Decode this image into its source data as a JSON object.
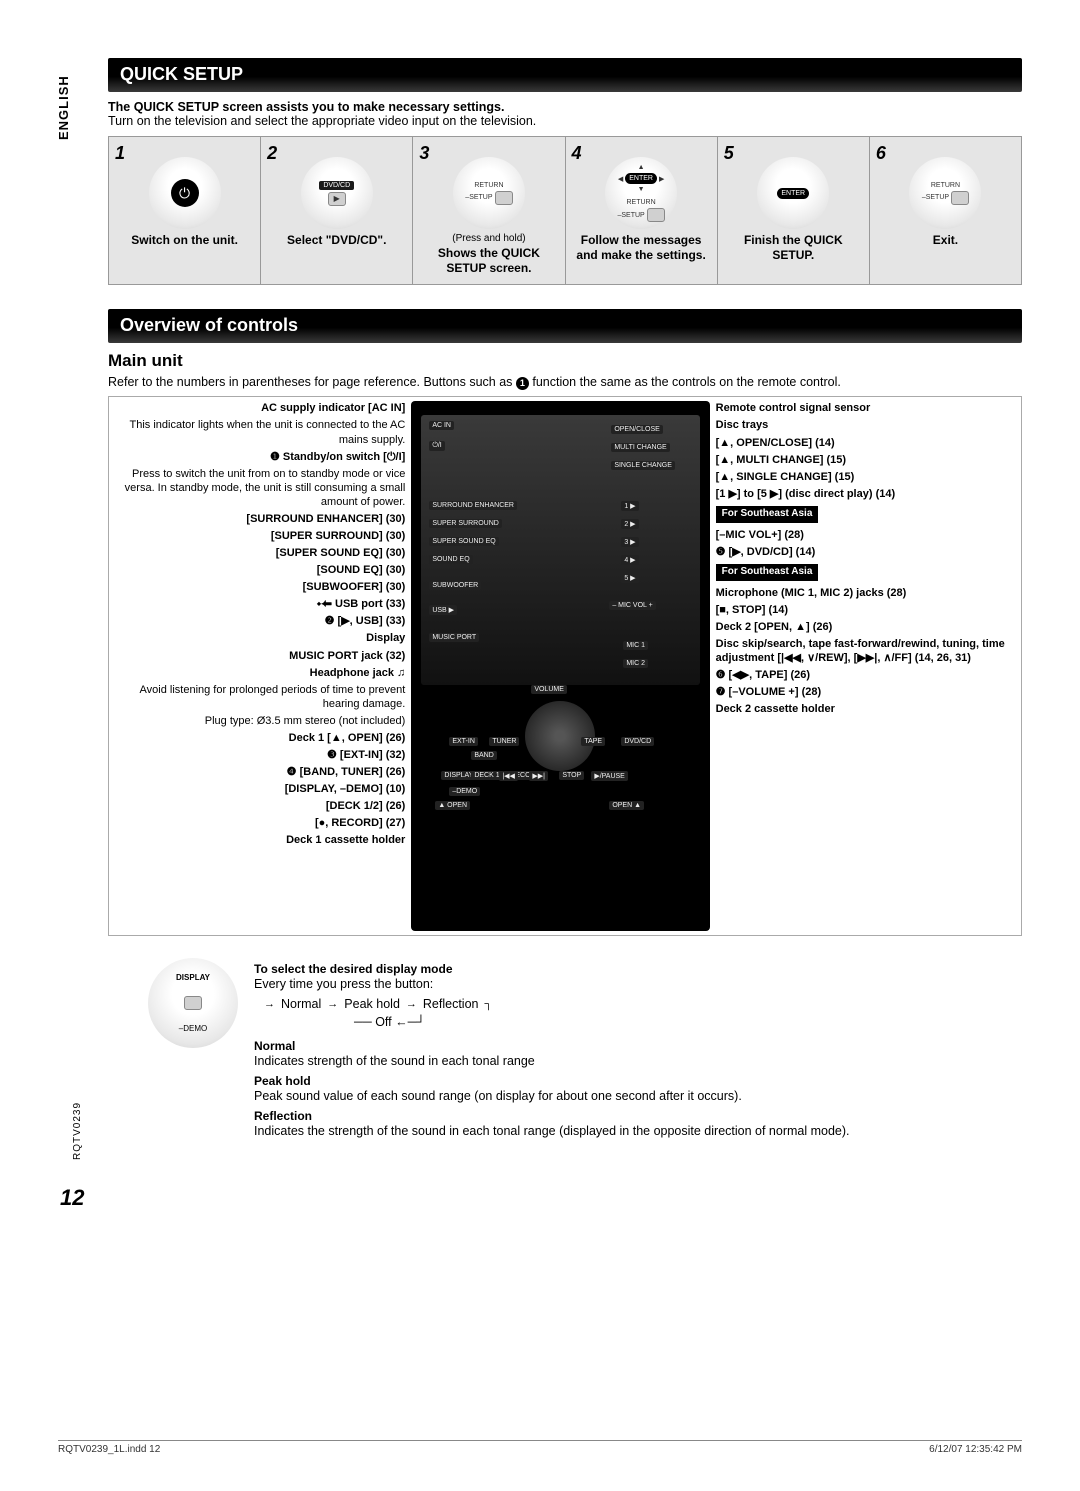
{
  "lang_tab": "ENGLISH",
  "page_number": "12",
  "doc_code": "RQTV0239",
  "section1": {
    "title": "QUICK SETUP",
    "lead_bold": "The QUICK SETUP screen assists you to make necessary settings.",
    "lead": "Turn on the television and select the appropriate video input on the television."
  },
  "steps": [
    {
      "n": "1",
      "label": "Switch on the unit.",
      "btn": {
        "type": "power"
      }
    },
    {
      "n": "2",
      "label": "Select \"DVD/CD\".",
      "btn": {
        "type": "dvdcd",
        "top": "DVD/CD"
      }
    },
    {
      "n": "3",
      "label": "Shows the QUICK SETUP screen.",
      "btn": {
        "type": "setup",
        "top": "RETURN",
        "left": "–SETUP"
      },
      "sub": "(Press and hold)"
    },
    {
      "n": "4",
      "label": "Follow the messages and make the settings.",
      "btn": {
        "type": "nav",
        "enter": "ENTER",
        "ret": "RETURN",
        "setup": "–SETUP"
      }
    },
    {
      "n": "5",
      "label": "Finish the QUICK SETUP.",
      "btn": {
        "type": "enter",
        "enter": "ENTER"
      }
    },
    {
      "n": "6",
      "label": "Exit.",
      "btn": {
        "type": "setup",
        "top": "RETURN",
        "left": "–SETUP"
      }
    }
  ],
  "section2": {
    "title": "Overview of controls",
    "sub": "Main unit",
    "desc_a": "Refer to the numbers in parentheses for page reference. Buttons such as ",
    "desc_b": " function the same as the controls on the remote control.",
    "circledRef": "1"
  },
  "left_callouts": [
    "AC supply indicator [AC IN]",
    "This indicator lights when the unit is connected to the AC mains supply.",
    "❶ Standby/on switch [⏻/I]",
    "Press to switch the unit from on to standby mode or vice versa. In standby mode, the unit is still consuming a small amount of power.",
    "[SURROUND ENHANCER] (30)",
    "[SUPER SURROUND] (30)",
    "[SUPER SOUND EQ] (30)",
    "[SOUND EQ] (30)",
    "[SUBWOOFER] (30)",
    "⬩⬅ USB port (33)",
    "❷ [▶, USB] (33)",
    "Display",
    "MUSIC PORT jack (32)",
    "Headphone jack ♫",
    "Avoid listening for prolonged periods of time to prevent hearing damage.",
    "Plug type: Ø3.5 mm stereo (not included)",
    "Deck 1 [▲, OPEN] (26)",
    "❸ [EXT-IN] (32)",
    "❹ [BAND, TUNER] (26)",
    "[DISPLAY, –DEMO] (10)",
    "[DECK 1/2] (26)",
    "[●, RECORD] (27)",
    "Deck 1 cassette holder"
  ],
  "right_callouts": [
    {
      "text": "Remote control signal sensor"
    },
    {
      "text": "Disc trays"
    },
    {
      "text": "[▲, OPEN/CLOSE] (14)"
    },
    {
      "text": "[▲, MULTI CHANGE] (15)"
    },
    {
      "text": "[▲, SINGLE CHANGE] (15)"
    },
    {
      "text": "[1 ▶] to [5 ▶] (disc direct play) (14)"
    },
    {
      "tag": "For Southeast Asia"
    },
    {
      "text": "[–MIC VOL+] (28)"
    },
    {
      "text": "❺ [▶, DVD/CD] (14)"
    },
    {
      "tag": "For Southeast Asia"
    },
    {
      "text": "Microphone (MIC 1, MIC 2) jacks (28)"
    },
    {
      "text": "[■, STOP] (14)"
    },
    {
      "text": "Deck 2 [OPEN, ▲] (26)"
    },
    {
      "text": "Disc skip/search, tape fast-forward/rewind, tuning, time adjustment [|◀◀, ∨/REW], [▶▶|, ∧/FF] (14, 26, 31)"
    },
    {
      "text": "❻ [◀▶, TAPE] (26)"
    },
    {
      "text": "❼ [–VOLUME +] (28)"
    },
    {
      "text": "Deck 2 cassette holder"
    }
  ],
  "unit_badges": [
    "AC IN",
    "⏻/I",
    "OPEN/CLOSE",
    "MULTI CHANGE",
    "SINGLE CHANGE",
    "SURROUND ENHANCER",
    "SUPER SURROUND",
    "SUPER SOUND EQ",
    "SOUND EQ",
    "SUBWOOFER",
    "USB ▶",
    "MUSIC PORT",
    "1 ▶",
    "2 ▶",
    "3 ▶",
    "4 ▶",
    "5 ▶",
    "– MIC VOL +",
    "MIC 1",
    "MIC 2",
    "VOLUME",
    "EXT-IN",
    "TUNER",
    "BAND",
    "DISPLAY",
    "DECK 1/2",
    "RECORD",
    "–DEMO",
    "TAPE",
    "DVD/CD",
    "▶/PAUSE",
    "STOP",
    "▶▶|",
    "|◀◀",
    "OPEN ▲",
    "▲ OPEN"
  ],
  "display_mode": {
    "btn_top": "DISPLAY",
    "btn_bottom": "–DEMO",
    "heading": "To select the desired display mode",
    "everytime": "Every time you press the button:",
    "cycle": [
      "Normal",
      "Peak hold",
      "Reflection"
    ],
    "off": "Off",
    "modes": [
      {
        "name": "Normal",
        "desc": "Indicates strength of the sound in each tonal range"
      },
      {
        "name": "Peak hold",
        "desc": "Peak sound value of each sound range (on display for about one second after it occurs)."
      },
      {
        "name": "Reflection",
        "desc": "Indicates the strength of the sound in each tonal range (displayed in the opposite direction of normal mode)."
      }
    ]
  },
  "footer": {
    "left": "RQTV0239_1L.indd   12",
    "right": "6/12/07   12:35:42 PM"
  }
}
